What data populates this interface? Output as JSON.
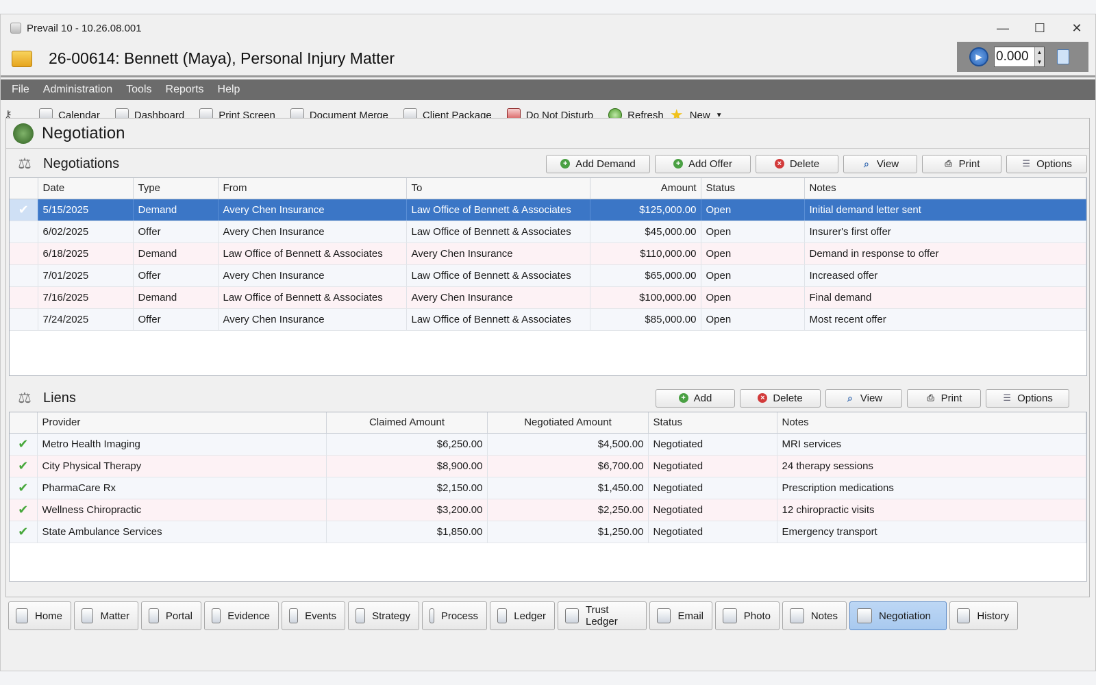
{
  "window": {
    "title": "Prevail 10 - 10.26.08.001",
    "controls": {
      "minimize": "—",
      "maximize": "☐",
      "close": "✕"
    }
  },
  "matter": {
    "title": "26-00614: Bennett (Maya), Personal Injury Matter",
    "timer_value": "0.000"
  },
  "menu": [
    "File",
    "Administration",
    "Tools",
    "Reports",
    "Help"
  ],
  "toolbar": [
    {
      "label": "Calendar",
      "icon": "calendar-icon"
    },
    {
      "label": "Dashboard",
      "icon": "dashboard-icon"
    },
    {
      "label": "Print Screen",
      "icon": "monitor-icon"
    },
    {
      "label": "Document Merge",
      "icon": "document-icon"
    },
    {
      "label": "Client Package",
      "icon": "package-icon"
    },
    {
      "label": "Do Not Disturb",
      "icon": "do-not-disturb-icon"
    },
    {
      "label": "Refresh",
      "icon": "refresh-icon"
    },
    {
      "label": "New",
      "icon": "star-icon"
    }
  ],
  "section": {
    "title": "Negotiation"
  },
  "negotiations": {
    "title": "Negotiations",
    "buttons": [
      "Add Demand",
      "Add Offer",
      "Delete",
      "View",
      "Print",
      "Options"
    ],
    "columns": [
      "Date",
      "Type",
      "From",
      "To",
      "Amount",
      "Status",
      "Notes"
    ],
    "rows": [
      {
        "date": "5/15/2025",
        "type": "Demand",
        "from": "Avery Chen Insurance",
        "to": "Law Office of Bennett & Associates",
        "amount": "$125,000.00",
        "status": "Open",
        "notes": "Initial demand letter sent",
        "selected": true
      },
      {
        "date": "6/02/2025",
        "type": "Offer",
        "from": "Avery Chen Insurance",
        "to": "Law Office of Bennett & Associates",
        "amount": "$45,000.00",
        "status": "Open",
        "notes": "Insurer's first offer"
      },
      {
        "date": "6/18/2025",
        "type": "Demand",
        "from": "Law Office of Bennett & Associates",
        "to": "Avery Chen Insurance",
        "amount": "$110,000.00",
        "status": "Open",
        "notes": "Demand in response to offer"
      },
      {
        "date": "7/01/2025",
        "type": "Offer",
        "from": "Avery Chen Insurance",
        "to": "Law Office of Bennett & Associates",
        "amount": "$65,000.00",
        "status": "Open",
        "notes": "Increased offer"
      },
      {
        "date": "7/16/2025",
        "type": "Demand",
        "from": "Law Office of Bennett & Associates",
        "to": "Avery Chen Insurance",
        "amount": "$100,000.00",
        "status": "Open",
        "notes": "Final demand"
      },
      {
        "date": "7/24/2025",
        "type": "Offer",
        "from": "Avery Chen Insurance",
        "to": "Law Office of Bennett & Associates",
        "amount": "$85,000.00",
        "status": "Open",
        "notes": "Most recent offer"
      }
    ]
  },
  "liens": {
    "title": "Liens",
    "buttons": [
      "Add",
      "Delete",
      "View",
      "Print",
      "Options"
    ],
    "columns": [
      "Provider",
      "Claimed Amount",
      "Negotiated Amount",
      "Status",
      "Notes"
    ],
    "rows": [
      {
        "provider": "Metro Health Imaging",
        "claimed": "$6,250.00",
        "negotiated": "$4,500.00",
        "status": "Negotiated",
        "notes": "MRI services"
      },
      {
        "provider": "City Physical Therapy",
        "claimed": "$8,900.00",
        "negotiated": "$6,700.00",
        "status": "Negotiated",
        "notes": "24 therapy sessions"
      },
      {
        "provider": "PharmaCare Rx",
        "claimed": "$2,150.00",
        "negotiated": "$1,450.00",
        "status": "Negotiated",
        "notes": "Prescription medications"
      },
      {
        "provider": "Wellness Chiropractic",
        "claimed": "$3,200.00",
        "negotiated": "$2,250.00",
        "status": "Negotiated",
        "notes": "12 chiropractic visits"
      },
      {
        "provider": "State Ambulance Services",
        "claimed": "$1,850.00",
        "negotiated": "$1,250.00",
        "status": "Negotiated",
        "notes": "Emergency transport"
      }
    ]
  },
  "tabs": [
    {
      "label": "Home",
      "icon": "home-icon"
    },
    {
      "label": "Matter",
      "icon": "folder-icon"
    },
    {
      "label": "Portal",
      "icon": "portal-icon"
    },
    {
      "label": "Evidence",
      "icon": "evidence-icon"
    },
    {
      "label": "Events",
      "icon": "events-icon"
    },
    {
      "label": "Strategy",
      "icon": "strategy-icon"
    },
    {
      "label": "Process",
      "icon": "gear-icon"
    },
    {
      "label": "Ledger",
      "icon": "ledger-icon"
    },
    {
      "label": "Trust Ledger",
      "icon": "scale-icon"
    },
    {
      "label": "Email",
      "icon": "email-icon"
    },
    {
      "label": "Photo",
      "icon": "photo-icon"
    },
    {
      "label": "Notes",
      "icon": "notes-icon"
    },
    {
      "label": "Negotiation",
      "icon": "scale-icon",
      "active": true
    },
    {
      "label": "History",
      "icon": "history-icon"
    }
  ],
  "colors": {
    "selection": "#3b76c6",
    "menubar": "#6b6b6b",
    "check": "#47a83b",
    "active_tab": "#bdd7f5"
  }
}
